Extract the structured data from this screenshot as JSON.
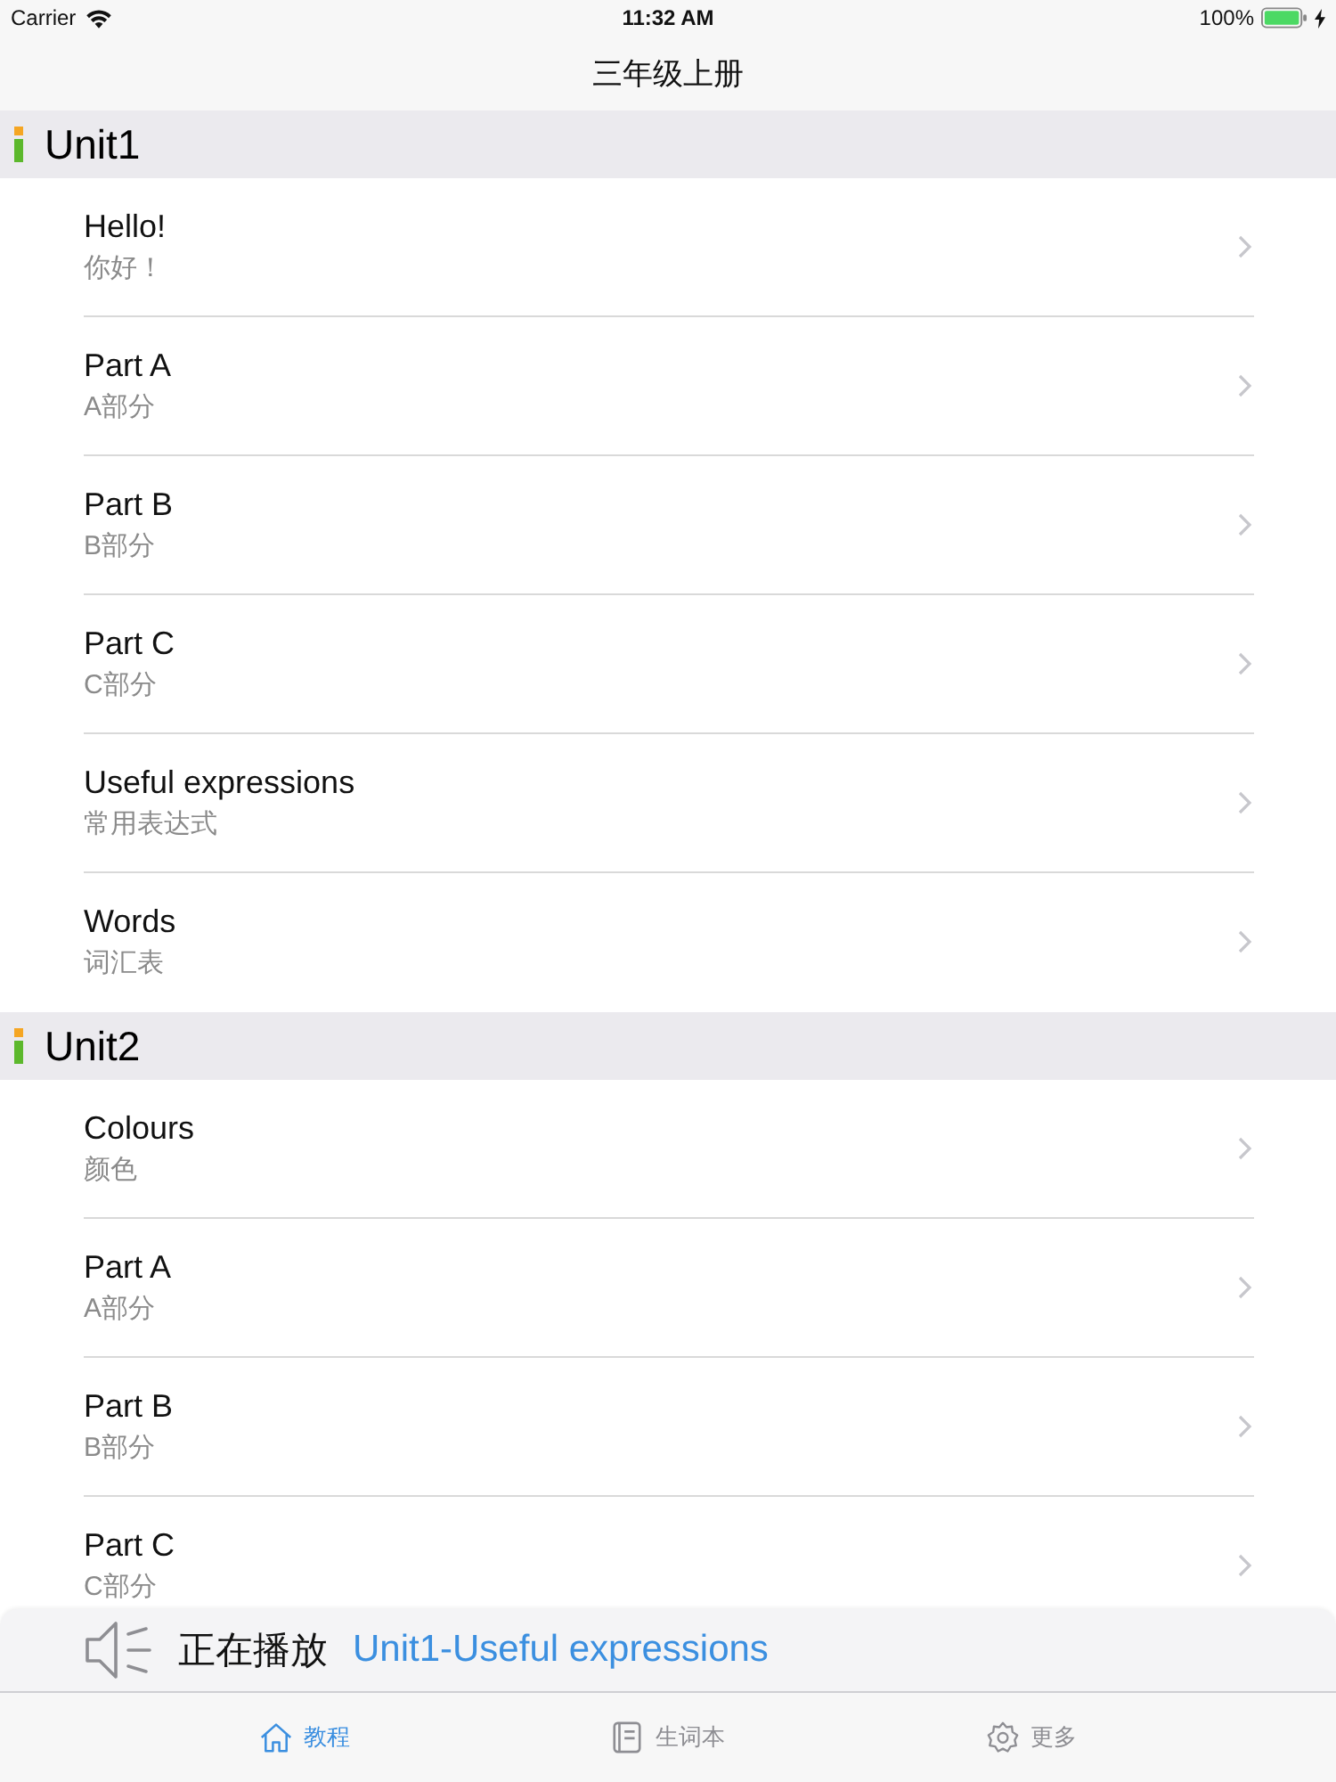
{
  "status_bar": {
    "carrier": "Carrier",
    "time": "11:32 AM",
    "battery": "100%"
  },
  "nav": {
    "title": "三年级上册"
  },
  "sections": [
    {
      "title": "Unit1",
      "rows": [
        {
          "title": "Hello!",
          "subtitle": "你好！"
        },
        {
          "title": "Part A",
          "subtitle": "A部分"
        },
        {
          "title": "Part B",
          "subtitle": "B部分"
        },
        {
          "title": "Part C",
          "subtitle": "C部分"
        },
        {
          "title": "Useful expressions",
          "subtitle": "常用表达式"
        },
        {
          "title": "Words",
          "subtitle": "词汇表"
        }
      ]
    },
    {
      "title": "Unit2",
      "rows": [
        {
          "title": "Colours",
          "subtitle": "颜色"
        },
        {
          "title": "Part A",
          "subtitle": "A部分"
        },
        {
          "title": "Part B",
          "subtitle": "B部分"
        },
        {
          "title": "Part C",
          "subtitle": "C部分"
        }
      ]
    }
  ],
  "now_playing": {
    "label": "正在播放",
    "track": "Unit1-Useful expressions"
  },
  "tabs": [
    {
      "label": "教程",
      "kind": "home",
      "selected": true
    },
    {
      "label": "生词本",
      "kind": "notebook",
      "selected": false
    },
    {
      "label": "更多",
      "kind": "gear",
      "selected": false
    }
  ]
}
